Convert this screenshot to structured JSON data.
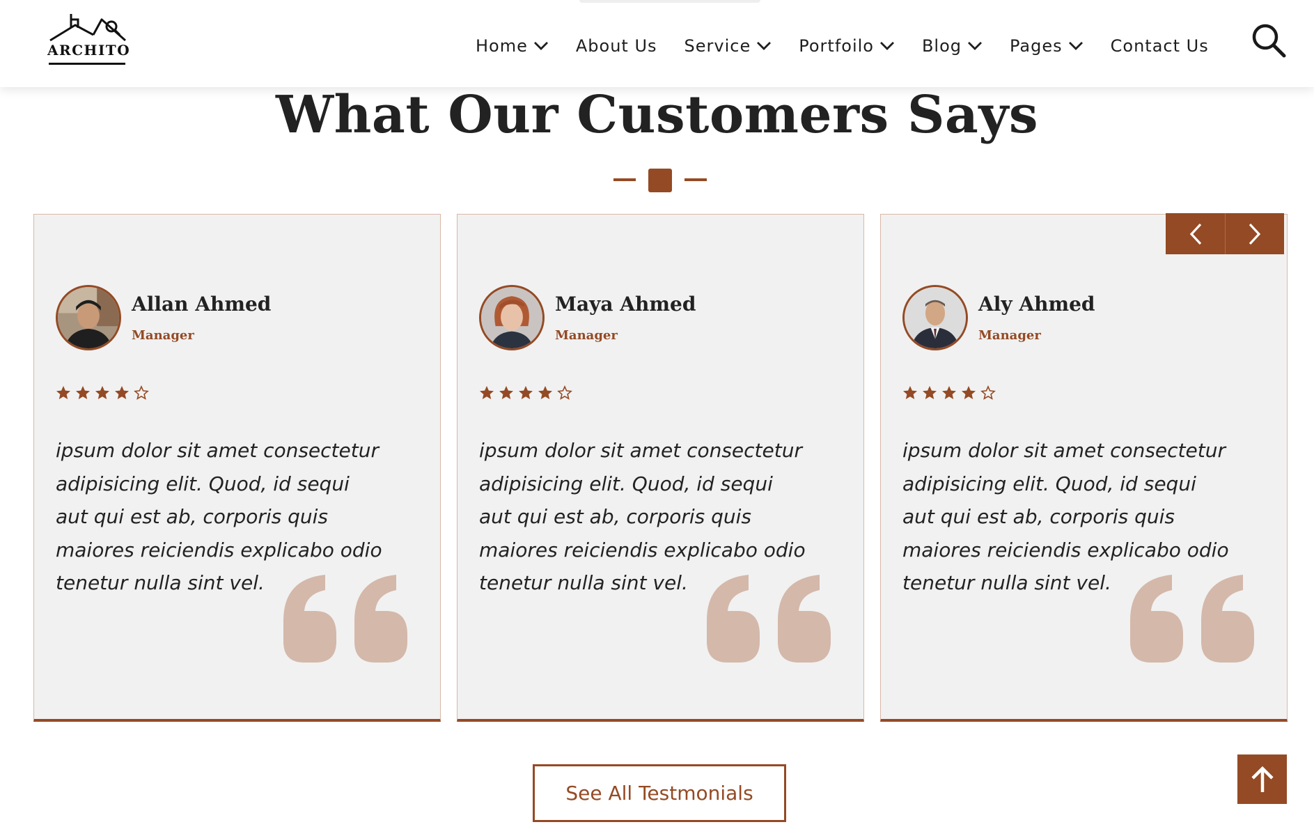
{
  "header": {
    "logo_text": "ARCHITO",
    "nav": [
      {
        "label": "Home",
        "has_dropdown": true
      },
      {
        "label": "About Us",
        "has_dropdown": false
      },
      {
        "label": "Service",
        "has_dropdown": true
      },
      {
        "label": "Portfoilo",
        "has_dropdown": true
      },
      {
        "label": "Blog",
        "has_dropdown": true
      },
      {
        "label": "Pages",
        "has_dropdown": true
      },
      {
        "label": "Contact Us",
        "has_dropdown": false
      }
    ],
    "search_icon": "search-icon"
  },
  "testimonials": {
    "title": "What Our Customers Says",
    "cards": [
      {
        "name": "Allan Ahmed",
        "role": "Manager",
        "rating": 4,
        "max_rating": 5,
        "text": "ipsum dolor sit amet consectetur adipisicing elit. Quod, id sequi aut qui est ab, corporis quis maiores reiciendis explicabo odio tenetur nulla sint vel."
      },
      {
        "name": "Maya Ahmed",
        "role": "Manager",
        "rating": 4,
        "max_rating": 5,
        "text": "ipsum dolor sit amet consectetur adipisicing elit. Quod, id sequi aut qui est ab, corporis quis maiores reiciendis explicabo odio tenetur nulla sint vel."
      },
      {
        "name": "Aly Ahmed",
        "role": "Manager",
        "rating": 4,
        "max_rating": 5,
        "text": "ipsum dolor sit amet consectetur adipisicing elit. Quod, id sequi aut qui est ab, corporis quis maiores reiciendis explicabo odio tenetur nulla sint vel."
      }
    ],
    "see_all_label": "See All Testmonials"
  },
  "icons": {
    "prev": "chevron-left-icon",
    "next": "chevron-right-icon",
    "back_to_top": "arrow-up-icon",
    "quote": "quote-icon",
    "star_filled": "star-filled-icon",
    "star_empty": "star-outline-icon"
  },
  "colors": {
    "accent": "#944a24",
    "card_bg": "#f1f1f1",
    "quote_mark": "#d4b8aa",
    "text": "#222222"
  }
}
